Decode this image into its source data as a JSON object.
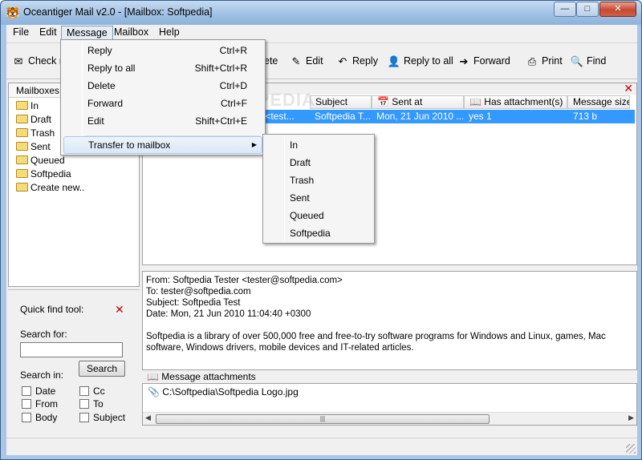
{
  "window": {
    "title": "Oceantiger Mail v2.0 - [Mailbox: Softpedia]",
    "buttons": {
      "minimize": "—",
      "maximize": "□",
      "close": "✕"
    }
  },
  "menubar": [
    "File",
    "Edit",
    "Message",
    "Mailbox",
    "Help"
  ],
  "toolbar": {
    "check": "Check m",
    "delete_partial": "ete",
    "edit": "Edit",
    "reply": "Reply",
    "reply_all": "Reply to all",
    "forward": "Forward",
    "print": "Print",
    "find": "Find"
  },
  "message_menu": {
    "items": [
      {
        "label": "Reply",
        "shortcut": "Ctrl+R"
      },
      {
        "label": "Reply to all",
        "shortcut": "Shift+Ctrl+R"
      },
      {
        "label": "Delete",
        "shortcut": "Ctrl+D"
      },
      {
        "label": "Forward",
        "shortcut": "Ctrl+F"
      },
      {
        "label": "Edit",
        "shortcut": "Shift+Ctrl+E"
      }
    ],
    "transfer": "Transfer to mailbox"
  },
  "transfer_submenu": [
    "In",
    "Draft",
    "Trash",
    "Sent",
    "Queued",
    "Softpedia"
  ],
  "sidebar": {
    "header": "Mailboxes",
    "items": [
      "In",
      "Draft",
      "Trash",
      "Sent",
      "Queued",
      "Softpedia",
      "Create new.."
    ]
  },
  "quickfind": {
    "title": "Quick find tool:",
    "search_for": "Search for:",
    "search_value": "",
    "search_button": "Search",
    "search_in": "Search in:",
    "options": [
      "Date",
      "Cc",
      "From",
      "To",
      "Body",
      "Subject"
    ]
  },
  "mail_list": {
    "columns": [
      "Subject",
      "Sent at",
      "Has attachment(s)",
      "Message size"
    ],
    "selected_row": {
      "from": "ster <test...",
      "subject": "Softpedia T...",
      "sent_at": "Mon, 21 Jun 2010 ...",
      "has_attachment": "yes 1",
      "size": "713 b"
    }
  },
  "preview": {
    "from": "From: Softpedia Tester <tester@softpedia.com>",
    "to": "To: tester@softpedia.com",
    "subject": "Subject: Softpedia Test",
    "date": "Date: Mon, 21 Jun 2010 11:04:40 +0300",
    "body_line1": "Softpedia is a library of over 500,000 free and free-to-try software programs for Windows and Linux, games, Mac",
    "body_line2": "software, Windows drivers, mobile devices and IT-related articles."
  },
  "attachments": {
    "header": "Message attachments",
    "items": [
      "C:\\Softpedia\\Softpedia Logo.jpg"
    ]
  },
  "watermark": "SOFTPEDIA",
  "colors": {
    "selection": "#3399ff",
    "close_x": "#cc0000"
  }
}
